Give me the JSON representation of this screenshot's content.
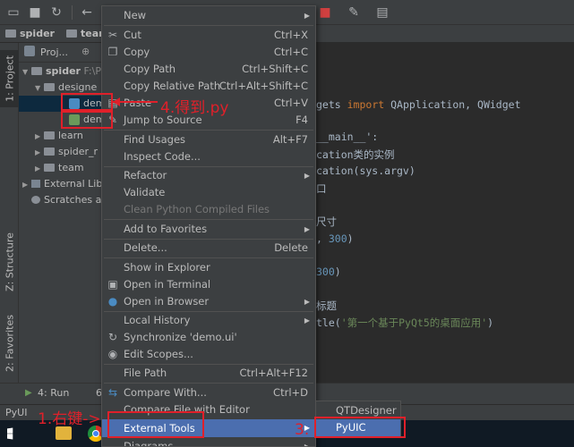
{
  "toolbar": {
    "icons": [
      "save-icon",
      "sync-icon",
      "back-icon",
      "stop-icon",
      "wrench-icon",
      "sdk-icon"
    ]
  },
  "navbar": {
    "crumbs": [
      "spider",
      "team"
    ]
  },
  "left_strip": {
    "tabs": [
      "1: Project",
      "Z: Structure",
      "2: Favorites"
    ]
  },
  "project": {
    "header": "Proj...",
    "tree": [
      {
        "label": "spider",
        "path": "F:\\P"
      },
      {
        "label": "designe"
      },
      {
        "label": "dem"
      },
      {
        "label": "dem"
      },
      {
        "label": "learn"
      },
      {
        "label": "spider_r"
      },
      {
        "label": "team"
      },
      {
        "label": "External Lib"
      },
      {
        "label": "Scratches a"
      }
    ]
  },
  "editor": {
    "lines": [
      {
        "pre": "gets ",
        "kw": "import",
        "post": " QApplication, QWidget"
      },
      {
        "text": "__main__':"
      },
      {
        "text": "cation类的实例"
      },
      {
        "text": "cation(sys.argv)"
      },
      {
        "text": "口"
      },
      {
        "text": "尺寸"
      },
      {
        "pre": ", ",
        "num": "300",
        "post": ")"
      },
      {
        "pre": "",
        "num": "300",
        "post": ")"
      },
      {
        "text": "标题"
      },
      {
        "pre": "tle(",
        "str": "'第一个基于PyQt5的桌面应用'",
        "post": ")"
      }
    ]
  },
  "bottom": {
    "run_label": "4: Run",
    "six_label": "6",
    "status_text": "PyUI"
  },
  "context_menu": {
    "items": [
      {
        "label": "New",
        "shortcut": "",
        "submenu": true
      },
      {
        "label": "Cut",
        "shortcut": "Ctrl+X",
        "icon": "scissors-icon"
      },
      {
        "label": "Copy",
        "shortcut": "Ctrl+C",
        "icon": "copy-icon"
      },
      {
        "label": "Copy Path",
        "shortcut": "Ctrl+Shift+C"
      },
      {
        "label": "Copy Relative Path",
        "shortcut": "Ctrl+Alt+Shift+C"
      },
      {
        "label": "Paste",
        "shortcut": "Ctrl+V",
        "icon": "paste-icon"
      },
      {
        "label": "Jump to Source",
        "shortcut": "F4",
        "icon": "pencil-icon"
      },
      {
        "label": "Find Usages",
        "shortcut": "Alt+F7"
      },
      {
        "label": "Inspect Code..."
      },
      {
        "label": "Refactor",
        "submenu": true
      },
      {
        "label": "Validate"
      },
      {
        "label": "Clean Python Compiled Files",
        "disabled": true
      },
      {
        "label": "Add to Favorites",
        "submenu": true
      },
      {
        "label": "Delete...",
        "shortcut": "Delete"
      },
      {
        "label": "Show in Explorer"
      },
      {
        "label": "Open in Terminal",
        "icon": "terminal-icon"
      },
      {
        "label": "Open in Browser",
        "submenu": true,
        "icon": "globe-icon"
      },
      {
        "label": "Local History",
        "submenu": true
      },
      {
        "label": "Synchronize 'demo.ui'",
        "icon": "sync-icon"
      },
      {
        "label": "Edit Scopes...",
        "icon": "scopes-icon"
      },
      {
        "label": "File Path",
        "shortcut": "Ctrl+Alt+F12"
      },
      {
        "label": "Compare With...",
        "shortcut": "Ctrl+D",
        "icon": "compare-icon"
      },
      {
        "label": "Compare File with Editor"
      },
      {
        "label": "External Tools",
        "submenu": true,
        "highlighted": true
      },
      {
        "label": "Diagrams",
        "submenu": true
      }
    ]
  },
  "submenu": {
    "items": [
      {
        "label": "QTDesigner"
      },
      {
        "label": "PyUIC",
        "highlighted": true
      }
    ]
  },
  "annotations": {
    "step1": "1.右键->",
    "step3": "3.",
    "step4": "4.得到.py"
  },
  "colors": {
    "annotation_red": "#e0202a",
    "menu_highlight": "#4b6eaf",
    "background": "#2b2b2b",
    "panel": "#3c3f41"
  }
}
